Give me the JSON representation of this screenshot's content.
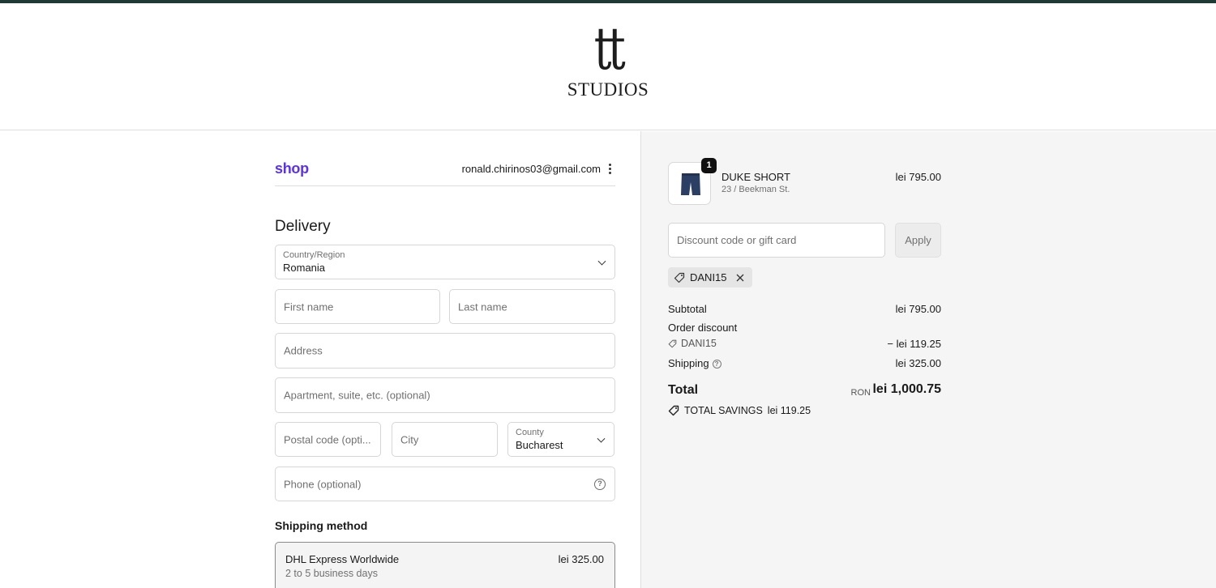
{
  "brand": {
    "mark": "tt",
    "word": "STUDIOS"
  },
  "account": {
    "shop_label": "shop",
    "email": "ronald.chirinos03@gmail.com"
  },
  "delivery": {
    "heading": "Delivery",
    "country": {
      "label": "Country/Region",
      "value": "Romania"
    },
    "first_name": {
      "placeholder": "First name"
    },
    "last_name": {
      "placeholder": "Last name"
    },
    "address": {
      "placeholder": "Address"
    },
    "apartment": {
      "placeholder": "Apartment, suite, etc. (optional)"
    },
    "postal": {
      "placeholder": "Postal code (opti..."
    },
    "city": {
      "placeholder": "City"
    },
    "county": {
      "label": "County",
      "value": "Bucharest"
    },
    "phone": {
      "placeholder": "Phone (optional)"
    }
  },
  "shipping_method": {
    "heading": "Shipping method",
    "option": {
      "name": "DHL Express Worldwide",
      "time": "2 to 5 business days",
      "price": "lei 325.00"
    }
  },
  "order": {
    "item": {
      "quantity": "1",
      "name": "DUKE SHORT",
      "variant": "23 / Beekman St.",
      "price": "lei 795.00"
    },
    "discount_placeholder": "Discount code or gift card",
    "apply_label": "Apply",
    "applied_code": "DANI15",
    "subtotal_label": "Subtotal",
    "subtotal_value": "lei 795.00",
    "order_discount_label": "Order discount",
    "discount_code": "DANI15",
    "discount_value": "− lei 119.25",
    "shipping_label": "Shipping",
    "shipping_value": "lei 325.00",
    "total_label": "Total",
    "currency": "RON",
    "total_value": "lei 1,000.75",
    "savings_label": "TOTAL SAVINGS",
    "savings_value": "lei 119.25"
  },
  "colors": {
    "accent": "#1f3a35",
    "shop_purple": "#5a31f4",
    "panel_bg": "#f5f5f5"
  }
}
